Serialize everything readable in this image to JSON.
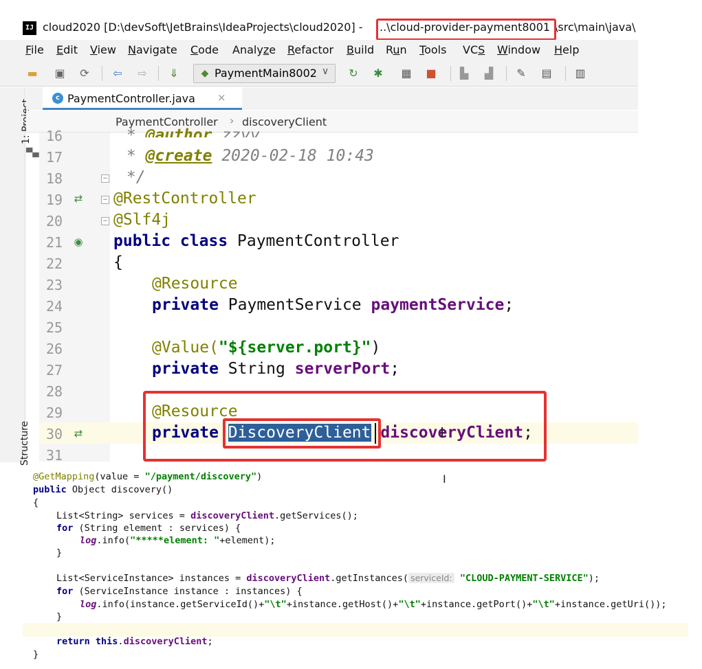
{
  "title_bar": {
    "logo": "IJ",
    "prefix": "cloud2020 [D:\\devSoft\\JetBrains\\IdeaProjects\\cloud2020] - ",
    "module": "..\\cloud-provider-payment8001",
    "suffix": "\\src\\main\\java\\"
  },
  "menu": [
    {
      "first": "F",
      "rest": "ile"
    },
    {
      "first": "E",
      "rest": "dit"
    },
    {
      "first": "V",
      "rest": "iew"
    },
    {
      "first": "N",
      "rest": "avigate"
    },
    {
      "first": "C",
      "rest": "ode"
    },
    {
      "first": "",
      "mid1": "Analy",
      "und": "z",
      "rest": "e"
    },
    {
      "first": "R",
      "rest": "efactor"
    },
    {
      "first": "B",
      "rest": "uild"
    },
    {
      "first": "",
      "mid1": "R",
      "und": "u",
      "rest": "n"
    },
    {
      "first": "T",
      "rest": "ools"
    },
    {
      "first": "",
      "mid1": "VC",
      "und": "S",
      "rest": ""
    },
    {
      "first": "W",
      "rest": "indow"
    },
    {
      "first": "H",
      "rest": "elp"
    }
  ],
  "toolbar": {
    "run_config": "PaymentMain8002",
    "icons": [
      "open-folder",
      "save",
      "sync",
      "back",
      "forward",
      "build",
      "run",
      "debug",
      "coverage",
      "stop",
      "project-structure",
      "sdk",
      "settings",
      "structure",
      "vcs"
    ]
  },
  "tool_windows": {
    "project": "1: Project",
    "structure": "Structure"
  },
  "editor_tab": {
    "file_name": "PaymentController.java",
    "icon_letter": "c"
  },
  "breadcrumb": {
    "class": "PaymentController",
    "member": "discoveryClient"
  },
  "editor": {
    "line_numbers": [
      "16",
      "17",
      "18",
      "19",
      "20",
      "21",
      "22",
      "23",
      "24",
      "25",
      "26",
      "27",
      "28",
      "29",
      "30",
      "31"
    ],
    "line16": {
      "star": " * ",
      "tag": "@author",
      "text": " zzyy"
    },
    "line17": {
      "star": " * ",
      "tag": "@create",
      "text": " 2020-02-18 10:43"
    },
    "line18": " */",
    "line19": "@RestController",
    "line20": "@Slf4j",
    "line21": {
      "kw": "public class",
      "name": " PaymentController"
    },
    "line22": "{",
    "line23": "@Resource",
    "line24": {
      "kw": "private",
      "type": " PaymentService ",
      "field": "paymentService",
      "end": ";"
    },
    "line26": {
      "ann": "@Value(",
      "str": "\"${server.port}\"",
      "end": ")"
    },
    "line27": {
      "kw": "private",
      "type": " String ",
      "field": "serverPort",
      "end": ";"
    },
    "line29": "@Resource",
    "line30": {
      "kw": "private",
      "type": "DiscoveryClient",
      "field": "discoveryClient",
      "end": ";"
    }
  },
  "snippet": {
    "l1": {
      "ann": "@GetMapping",
      "a": "(value = ",
      "str": "\"/payment/discovery\"",
      "b": ")"
    },
    "l2": {
      "kw": "public",
      "a": " Object discovery()"
    },
    "l3": "{",
    "l4": {
      "a": "List<String> services = ",
      "fld": "discoveryClient",
      "b": ".getServices();"
    },
    "l5": {
      "kw": "for",
      "a": " (String element : services) {"
    },
    "l6": {
      "log": "log",
      "a": ".info(",
      "str": "\"*****element: \"",
      "b": "+element);"
    },
    "l7": "}",
    "l8": {
      "a": "List<ServiceInstance> instances = ",
      "fld": "discoveryClient",
      "b": ".getInstances(",
      "hint": "serviceId:",
      "str": "\"CLOUD-PAYMENT-SERVICE\"",
      "c": ");"
    },
    "l9": {
      "kw": "for",
      "a": " (ServiceInstance instance : instances) {"
    },
    "l10": {
      "log": "log",
      "a": ".info(instance.getServiceId()+",
      "s1": "\"\\t\"",
      "b": "+instance.getHost()+",
      "s2": "\"\\t\"",
      "c": "+instance.getPort()+",
      "s3": "\"\\t\"",
      "d": "+instance.getUri());"
    },
    "l11": "}",
    "l12": {
      "kw": "return",
      "kw2": " this",
      "a": ".",
      "fld": "discoveryClient",
      "b": ";"
    },
    "l13": "}"
  },
  "colors": {
    "highlight_box": "#e53232",
    "selection": "#2d5f9a",
    "keyword": "#000080",
    "annotation": "#808000",
    "string": "#008000",
    "field": "#660e7a"
  }
}
